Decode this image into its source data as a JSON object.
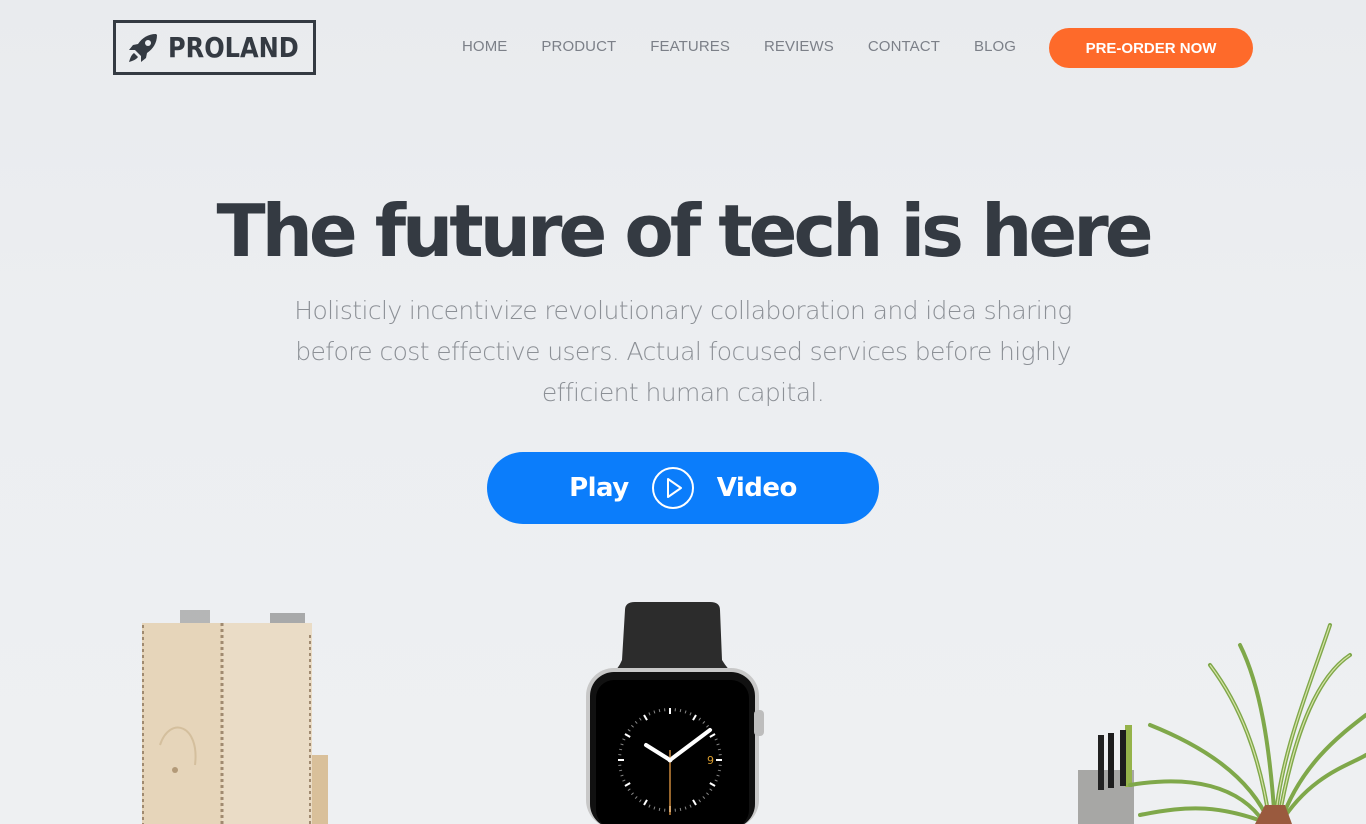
{
  "brand": {
    "name": "PROLAND",
    "icon": "rocket-icon"
  },
  "nav": {
    "items": [
      {
        "label": "HOME"
      },
      {
        "label": "PRODUCT"
      },
      {
        "label": "FEATURES"
      },
      {
        "label": "REVIEWS"
      },
      {
        "label": "CONTACT"
      },
      {
        "label": "BLOG"
      }
    ],
    "cta_label": "PRE-ORDER NOW"
  },
  "hero": {
    "title": "The future of tech is here",
    "subtitle": "Holisticly incentivize revolutionary collaboration and idea sharing before cost effective users. Actual focused services before highly efficient human capital.",
    "play_button": {
      "left_label": "Play",
      "right_label": "Video",
      "icon": "play-circle-icon"
    }
  },
  "images": {
    "left": "wooden-magazine-organizer",
    "center": "smartwatch",
    "right": "plant-and-pen-holder",
    "watch_face_number": "9"
  },
  "colors": {
    "text_dark": "#343a42",
    "nav_text": "#7c8088",
    "accent_orange": "#fe6a2a",
    "accent_blue": "#0b7dfb",
    "subtitle": "#8c9096",
    "background": "#eceef1"
  }
}
